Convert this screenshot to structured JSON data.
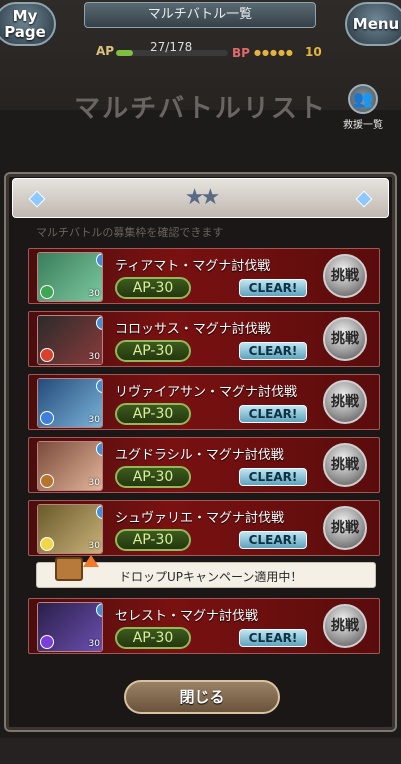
{
  "header": {
    "mypage_label": "My Page",
    "menu_label": "Menu",
    "title": "マルチバトル一覧",
    "ap_label": "AP",
    "ap_value": "27/178",
    "ap_fraction": 0.15,
    "bp_label": "BP",
    "bp_dots": "●●●●●",
    "bp_value": "10"
  },
  "page": {
    "big_title": "マルチバトルリスト",
    "rescue_label": "救援一覧"
  },
  "panel": {
    "stars": "★★",
    "subtext": "マルチバトルの募集枠を確認できます"
  },
  "battles": [
    {
      "name": "ティアマト・マグナ討伐戦",
      "ap": "AP-30",
      "status": "CLEAR!",
      "level": "30",
      "button": "挑戦",
      "colors": [
        "#3a7d5a",
        "#7cc9a0"
      ],
      "element": "#3fa653"
    },
    {
      "name": "コロッサス・マグナ討伐戦",
      "ap": "AP-30",
      "status": "CLEAR!",
      "level": "30",
      "button": "挑戦",
      "colors": [
        "#2b2b2b",
        "#8a3b3b"
      ],
      "element": "#d9412b"
    },
    {
      "name": "リヴァイアサン・マグナ討伐戦",
      "ap": "AP-30",
      "status": "CLEAR!",
      "level": "30",
      "button": "挑戦",
      "colors": [
        "#234b7a",
        "#7bb3d8"
      ],
      "element": "#3d7fd9"
    },
    {
      "name": "ユグドラシル・マグナ討伐戦",
      "ap": "AP-30",
      "status": "CLEAR!",
      "level": "30",
      "button": "挑戦",
      "colors": [
        "#7a4b3a",
        "#e2b59a"
      ],
      "element": "#b8732d"
    },
    {
      "name": "シュヴァリエ・マグナ討伐戦",
      "ap": "AP-30",
      "status": "CLEAR!",
      "level": "30",
      "button": "挑戦",
      "colors": [
        "#6a5a2a",
        "#c9b27a"
      ],
      "element": "#f1d64a"
    },
    {
      "name": "セレスト・マグナ討伐戦",
      "ap": "AP-30",
      "status": "CLEAR!",
      "level": "30",
      "button": "挑戦",
      "colors": [
        "#2a1f4a",
        "#6a4fb0"
      ],
      "element": "#7a3fd9"
    }
  ],
  "banner": {
    "text": "ドロップUPキャンペーン適用中！"
  },
  "close_label": "閉じる"
}
